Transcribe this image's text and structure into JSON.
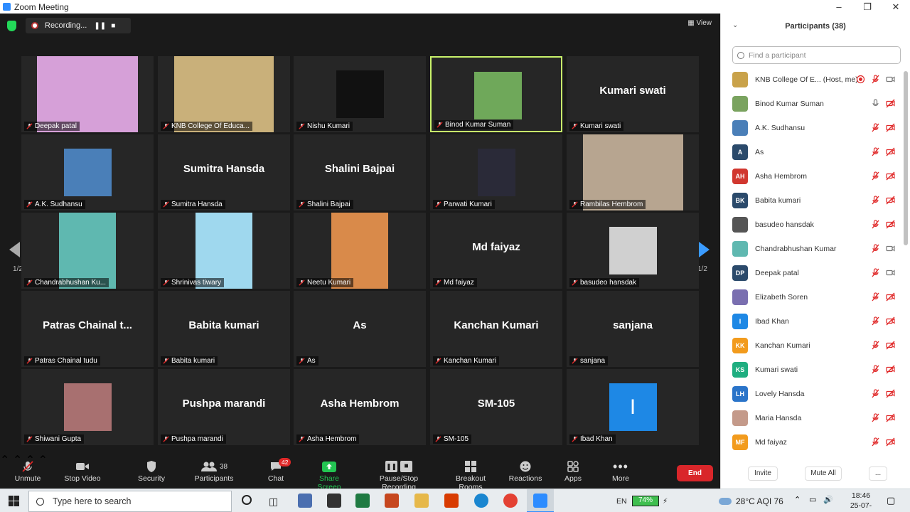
{
  "window": {
    "title": "Zoom Meeting"
  },
  "recording": {
    "label": "Recording..."
  },
  "top_actions": {
    "view_label": "View"
  },
  "pager": {
    "left": "1/2",
    "right": "1/2"
  },
  "tiles": [
    {
      "label": "Deepak patal",
      "big": "",
      "video": "#d6a0d8"
    },
    {
      "label": "KNB College Of Educa...",
      "big": "",
      "video": "#c9b07a"
    },
    {
      "label": "Nishu Kumari",
      "big": "",
      "video": "#111111"
    },
    {
      "label": "Binod Kumar Suman",
      "big": "",
      "video": "#6fa85a"
    },
    {
      "label": "Kumari swati",
      "big": "Kumari swati",
      "video": ""
    },
    {
      "label": "A.K. Sudhansu",
      "big": "",
      "video": "#4a7fb8"
    },
    {
      "label": "Sumitra Hansda",
      "big": "Sumitra Hansda",
      "video": ""
    },
    {
      "label": "Shalini Bajpai",
      "big": "Shalini Bajpai",
      "video": ""
    },
    {
      "label": "Parwati Kumari",
      "big": "",
      "video": "#2a2a38"
    },
    {
      "label": "Rambilas Hembrom",
      "big": "",
      "video": "#b7a590"
    },
    {
      "label": "Chandrabhushan Ku...",
      "big": "",
      "video": "#5fb8b0"
    },
    {
      "label": "Shrinivas tiwary",
      "big": "",
      "video": "#9fd8ee"
    },
    {
      "label": "Neetu Kumari",
      "big": "",
      "video": "#d98a4a"
    },
    {
      "label": "Md faiyaz",
      "big": "Md faiyaz",
      "video": ""
    },
    {
      "label": "basudeo hansdak",
      "big": "",
      "video": "#d0d0d0"
    },
    {
      "label": "Patras Chainal tudu",
      "big": "Patras Chainal t...",
      "video": ""
    },
    {
      "label": "Babita kumari",
      "big": "Babita kumari",
      "video": ""
    },
    {
      "label": "As",
      "big": "As",
      "video": ""
    },
    {
      "label": "Kanchan Kumari",
      "big": "Kanchan Kumari",
      "video": ""
    },
    {
      "label": "sanjana",
      "big": "sanjana",
      "video": ""
    },
    {
      "label": "Shiwani Gupta",
      "big": "",
      "video": "#a87070"
    },
    {
      "label": "Pushpa marandi",
      "big": "Pushpa marandi",
      "video": ""
    },
    {
      "label": "Asha Hembrom",
      "big": "Asha Hembrom",
      "video": ""
    },
    {
      "label": "SM-105",
      "big": "SM-105",
      "video": ""
    },
    {
      "label": "Ibad Khan",
      "big": "",
      "video": "#1e88e5",
      "letter": "I"
    }
  ],
  "toolbar": {
    "unmute": "Unmute",
    "stop_video": "Stop Video",
    "security": "Security",
    "participants": "Participants",
    "participants_count": "38",
    "chat": "Chat",
    "chat_badge": "42",
    "share_screen": "Share Screen",
    "pause_recording": "Pause/Stop Recording",
    "breakout": "Breakout Rooms",
    "reactions": "Reactions",
    "apps": "Apps",
    "more": "More",
    "end": "End"
  },
  "panel": {
    "title": "Participants (38)",
    "search_placeholder": "Find a participant",
    "invite": "Invite",
    "mute_all": "Mute All",
    "more": "...",
    "participants": [
      {
        "name": "KNB College Of E...",
        "suffix": "(Host, me)",
        "initials": "",
        "color": "#c9a24a",
        "mic": "muted",
        "video": "on",
        "rec": true
      },
      {
        "name": "Binod Kumar Suman",
        "suffix": "",
        "initials": "",
        "color": "#7aa35f",
        "mic": "on",
        "video": "off"
      },
      {
        "name": "A.K. Sudhansu",
        "suffix": "",
        "initials": "",
        "color": "#4a7fb8",
        "mic": "muted",
        "video": "off"
      },
      {
        "name": "As",
        "suffix": "",
        "initials": "A",
        "color": "#2b4a6b",
        "mic": "muted",
        "video": "off"
      },
      {
        "name": "Asha Hembrom",
        "suffix": "",
        "initials": "AH",
        "color": "#d1372f",
        "mic": "muted",
        "video": "off"
      },
      {
        "name": "Babita kumari",
        "suffix": "",
        "initials": "BK",
        "color": "#2b4a6b",
        "mic": "muted",
        "video": "off"
      },
      {
        "name": "basudeo hansdak",
        "suffix": "",
        "initials": "",
        "color": "#555555",
        "mic": "muted",
        "video": "off"
      },
      {
        "name": "Chandrabhushan Kumar",
        "suffix": "",
        "initials": "",
        "color": "#5fb8b0",
        "mic": "muted",
        "video": "on"
      },
      {
        "name": "Deepak patal",
        "suffix": "",
        "initials": "DP",
        "color": "#2b4a6b",
        "mic": "muted",
        "video": "on"
      },
      {
        "name": "Elizabeth Soren",
        "suffix": "",
        "initials": "",
        "color": "#7a6fb0",
        "mic": "muted",
        "video": "off"
      },
      {
        "name": "Ibad Khan",
        "suffix": "",
        "initials": "I",
        "color": "#1e88e5",
        "mic": "muted",
        "video": "off"
      },
      {
        "name": "Kanchan Kumari",
        "suffix": "",
        "initials": "KK",
        "color": "#f29b1d",
        "mic": "muted",
        "video": "off"
      },
      {
        "name": "Kumari swati",
        "suffix": "",
        "initials": "KS",
        "color": "#1fae80",
        "mic": "muted",
        "video": "off"
      },
      {
        "name": "Lovely Hansda",
        "suffix": "",
        "initials": "LH",
        "color": "#2a74c9",
        "mic": "muted",
        "video": "off"
      },
      {
        "name": "Maria Hansda",
        "suffix": "",
        "initials": "",
        "color": "#c49a8a",
        "mic": "muted",
        "video": "off"
      },
      {
        "name": "Md faiyaz",
        "suffix": "",
        "initials": "MF",
        "color": "#f29b1d",
        "mic": "muted",
        "video": "off"
      }
    ]
  },
  "taskbar": {
    "search_placeholder": "Type here to search",
    "lang": "EN",
    "battery": "74%",
    "weather": "28°C  AQI 76",
    "time": "18:46",
    "date": "25-07-2021"
  },
  "colors": {
    "accent": "#2d8cff",
    "end": "#d9262a",
    "active_speaker": "#c9f26b",
    "muted": "#e02828"
  }
}
